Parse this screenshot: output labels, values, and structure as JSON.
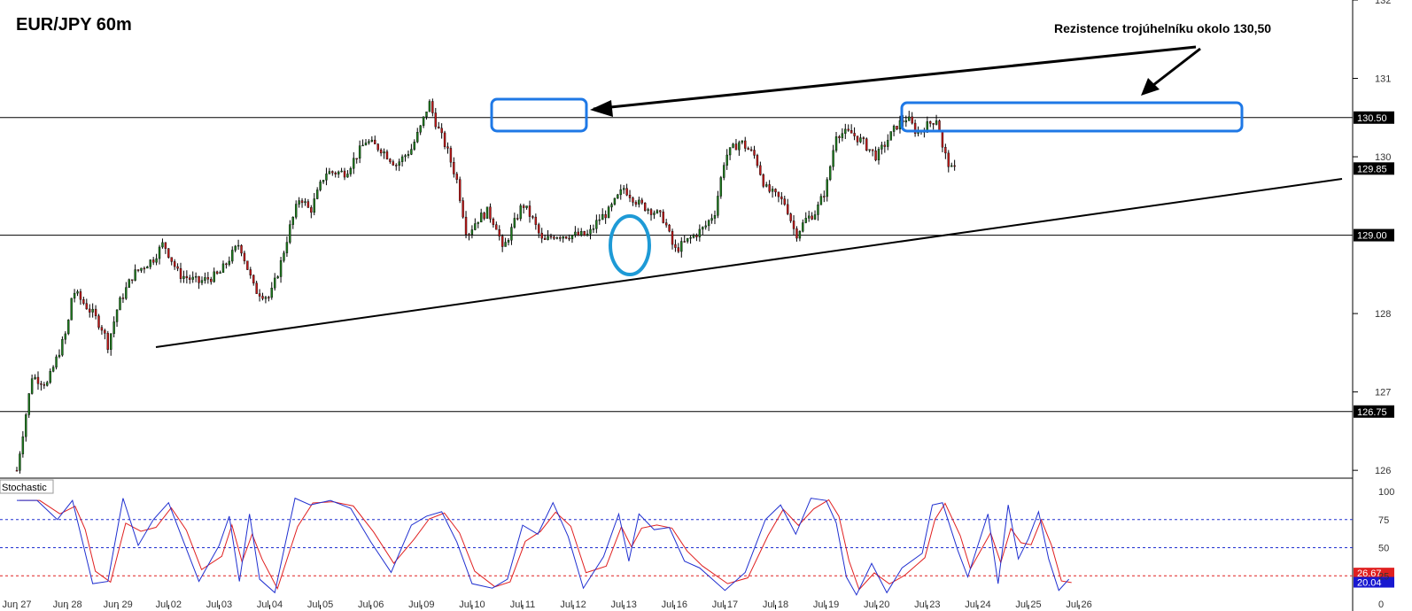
{
  "chart_title": "EUR/JPY 60m",
  "annotation": "Rezistence trojúhelníku okolo 130,50",
  "colors": {
    "background": "#ffffff",
    "bull": "#1e7a1e",
    "bear": "#c01818",
    "wick": "#000000",
    "highlight": "#1e78e6",
    "stoch_k": "#2030d0",
    "stoch_d": "#e02020"
  },
  "chart_data": [
    {
      "type": "candlestick",
      "title": "EUR/JPY 60m",
      "ylim": [
        125.9,
        132.0
      ],
      "y_ticks": [
        "126",
        "127",
        "128",
        "130",
        "131",
        "132"
      ],
      "x_ticks": [
        "Jun 27",
        "Jun 28",
        "Jun 29",
        "Jul 02",
        "Jul 03",
        "Jul 04",
        "Jul 05",
        "Jul 06",
        "Jul 09",
        "Jul 10",
        "Jul 11",
        "Jul 12",
        "Jul 13",
        "Jul 16",
        "Jul 17",
        "Jul 18",
        "Jul 19",
        "Jul 20",
        "Jul 23",
        "Jul 24",
        "Jul 25",
        "Jul 26"
      ],
      "close_path": [
        [
          0,
          126.0
        ],
        [
          0.3,
          127.2
        ],
        [
          0.6,
          127.1
        ],
        [
          1.0,
          127.8
        ],
        [
          1.1,
          128.3
        ],
        [
          1.5,
          128.0
        ],
        [
          1.7,
          127.8
        ],
        [
          1.8,
          127.6
        ],
        [
          2.0,
          128.1
        ],
        [
          2.3,
          128.5
        ],
        [
          2.7,
          128.7
        ],
        [
          2.9,
          128.9
        ],
        [
          3.2,
          128.5
        ],
        [
          3.6,
          128.4
        ],
        [
          4.0,
          128.5
        ],
        [
          4.2,
          128.7
        ],
        [
          4.4,
          128.9
        ],
        [
          4.7,
          128.3
        ],
        [
          5.0,
          128.2
        ],
        [
          5.2,
          128.6
        ],
        [
          5.4,
          129.1
        ],
        [
          5.6,
          129.5
        ],
        [
          5.8,
          129.3
        ],
        [
          6.1,
          129.8
        ],
        [
          6.5,
          129.8
        ],
        [
          6.9,
          130.2
        ],
        [
          7.2,
          130.1
        ],
        [
          7.5,
          129.9
        ],
        [
          7.8,
          130.1
        ],
        [
          8.0,
          130.4
        ],
        [
          8.15,
          130.7
        ],
        [
          8.3,
          130.4
        ],
        [
          8.5,
          130.1
        ],
        [
          8.7,
          129.7
        ],
        [
          8.9,
          129.0
        ],
        [
          9.1,
          129.2
        ],
        [
          9.3,
          129.3
        ],
        [
          9.5,
          129.1
        ],
        [
          9.6,
          128.8
        ],
        [
          9.8,
          129.1
        ],
        [
          10.0,
          129.4
        ],
        [
          10.2,
          129.2
        ],
        [
          10.4,
          128.9
        ],
        [
          10.6,
          129.0
        ],
        [
          11.0,
          129.0
        ],
        [
          11.3,
          129.0
        ],
        [
          11.5,
          129.2
        ],
        [
          11.7,
          129.3
        ],
        [
          12.0,
          129.6
        ],
        [
          12.3,
          129.4
        ],
        [
          12.6,
          129.3
        ],
        [
          12.8,
          129.2
        ],
        [
          13.0,
          128.8
        ],
        [
          13.2,
          128.9
        ],
        [
          13.4,
          129.0
        ],
        [
          13.6,
          129.1
        ],
        [
          13.8,
          129.3
        ],
        [
          14.0,
          130.0
        ],
        [
          14.3,
          130.2
        ],
        [
          14.6,
          130.0
        ],
        [
          14.8,
          129.6
        ],
        [
          15.0,
          129.5
        ],
        [
          15.2,
          129.4
        ],
        [
          15.4,
          129.0
        ],
        [
          15.6,
          129.2
        ],
        [
          15.8,
          129.3
        ],
        [
          16.0,
          129.6
        ],
        [
          16.2,
          130.3
        ],
        [
          16.5,
          130.3
        ],
        [
          16.7,
          130.2
        ],
        [
          17.0,
          130.0
        ],
        [
          17.2,
          130.2
        ],
        [
          17.4,
          130.4
        ],
        [
          17.6,
          130.5
        ],
        [
          17.8,
          130.3
        ],
        [
          18.0,
          130.4
        ],
        [
          18.2,
          130.5
        ],
        [
          18.3,
          130.1
        ],
        [
          18.5,
          129.8
        ],
        [
          18.55,
          129.85
        ]
      ],
      "stochastic": {
        "label": "Stochastic",
        "ylim": [
          0,
          100
        ],
        "y_ticks": [
          "100",
          "75",
          "50",
          "25",
          "0"
        ],
        "k_last": "20.04",
        "d_last": "26.67",
        "k": [
          [
            0,
            92
          ],
          [
            0.4,
            92
          ],
          [
            0.8,
            75
          ],
          [
            1.1,
            92
          ],
          [
            1.3,
            55
          ],
          [
            1.5,
            18
          ],
          [
            1.8,
            20
          ],
          [
            2.1,
            94
          ],
          [
            2.4,
            52
          ],
          [
            2.7,
            75
          ],
          [
            3.0,
            90
          ],
          [
            3.3,
            55
          ],
          [
            3.6,
            20
          ],
          [
            4.0,
            52
          ],
          [
            4.2,
            78
          ],
          [
            4.4,
            20
          ],
          [
            4.6,
            80
          ],
          [
            4.8,
            22
          ],
          [
            5.1,
            10
          ],
          [
            5.5,
            94
          ],
          [
            5.8,
            88
          ],
          [
            6.2,
            92
          ],
          [
            6.6,
            85
          ],
          [
            7.0,
            55
          ],
          [
            7.4,
            28
          ],
          [
            7.8,
            70
          ],
          [
            8.1,
            78
          ],
          [
            8.4,
            82
          ],
          [
            8.7,
            55
          ],
          [
            9.0,
            18
          ],
          [
            9.4,
            14
          ],
          [
            9.7,
            22
          ],
          [
            10.0,
            70
          ],
          [
            10.3,
            62
          ],
          [
            10.6,
            90
          ],
          [
            10.9,
            60
          ],
          [
            11.2,
            14
          ],
          [
            11.6,
            42
          ],
          [
            11.9,
            80
          ],
          [
            12.1,
            38
          ],
          [
            12.3,
            80
          ],
          [
            12.6,
            66
          ],
          [
            12.9,
            68
          ],
          [
            13.2,
            38
          ],
          [
            13.5,
            32
          ],
          [
            14.0,
            12
          ],
          [
            14.4,
            28
          ],
          [
            14.8,
            75
          ],
          [
            15.1,
            88
          ],
          [
            15.4,
            62
          ],
          [
            15.7,
            94
          ],
          [
            16.0,
            92
          ],
          [
            16.2,
            72
          ],
          [
            16.4,
            24
          ],
          [
            16.6,
            8
          ],
          [
            16.9,
            36
          ],
          [
            17.2,
            10
          ],
          [
            17.5,
            32
          ],
          [
            17.9,
            45
          ],
          [
            18.1,
            88
          ],
          [
            18.3,
            90
          ],
          [
            18.6,
            48
          ],
          [
            18.8,
            24
          ],
          [
            19.2,
            80
          ],
          [
            19.4,
            18
          ],
          [
            19.6,
            88
          ],
          [
            19.8,
            40
          ],
          [
            20.0,
            58
          ],
          [
            20.2,
            82
          ],
          [
            20.4,
            40
          ],
          [
            20.6,
            12
          ],
          [
            20.8,
            22
          ]
        ]
      }
    }
  ],
  "levels": [
    {
      "value": 130.5,
      "label": "130.50"
    },
    {
      "value": 129.85,
      "label": "129.85"
    },
    {
      "value": 129.0,
      "label": "129.00"
    },
    {
      "value": 126.75,
      "label": "126.75"
    }
  ]
}
